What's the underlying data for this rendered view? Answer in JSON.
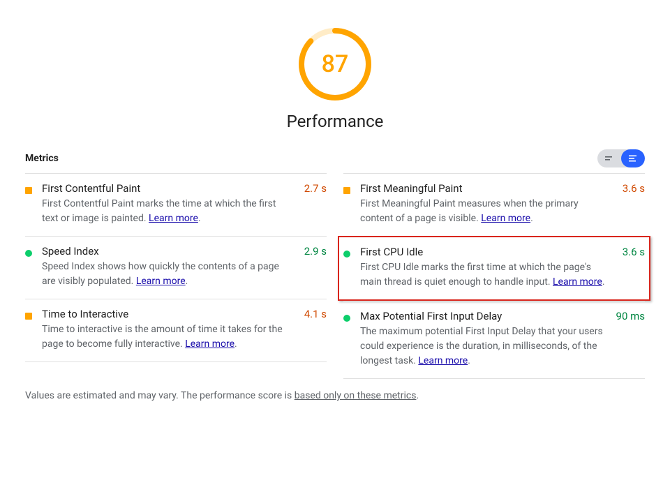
{
  "gauge": {
    "score": "87",
    "title": "Performance",
    "percent": 87,
    "color": "#FFA400",
    "bg": "#FFECC7"
  },
  "metrics_header": "Metrics",
  "learn_more_label": "Learn more",
  "left": [
    {
      "title": "First Contentful Paint",
      "value": "2.7 s",
      "status": "average",
      "shape": "square",
      "color": "#FFA400",
      "desc_pre": "First Contentful Paint marks the time at which the first text or image is painted. ",
      "desc_post": "."
    },
    {
      "title": "Speed Index",
      "value": "2.9 s",
      "status": "pass",
      "shape": "circle",
      "color": "#0CCE6B",
      "desc_pre": "Speed Index shows how quickly the contents of a page are visibly populated. ",
      "desc_post": "."
    },
    {
      "title": "Time to Interactive",
      "value": "4.1 s",
      "status": "average",
      "shape": "square",
      "color": "#FFA400",
      "desc_pre": "Time to interactive is the amount of time it takes for the page to become fully interactive. ",
      "desc_post": "."
    }
  ],
  "right": [
    {
      "title": "First Meaningful Paint",
      "value": "3.6 s",
      "status": "average",
      "shape": "square",
      "color": "#FFA400",
      "desc_pre": "First Meaningful Paint measures when the primary content of a page is visible. ",
      "desc_post": "."
    },
    {
      "title": "First CPU Idle",
      "value": "3.6 s",
      "status": "pass",
      "shape": "circle",
      "color": "#0CCE6B",
      "highlight": true,
      "desc_pre": "First CPU Idle marks the first time at which the page's main thread is quiet enough to handle input. ",
      "desc_post": "."
    },
    {
      "title": "Max Potential First Input Delay",
      "value": "90 ms",
      "status": "pass",
      "shape": "circle",
      "color": "#0CCE6B",
      "desc_pre": "The maximum potential First Input Delay that your users could experience is the duration, in milliseconds, of the longest task. ",
      "desc_post": "."
    }
  ],
  "footnote": {
    "pre": "Values are estimated and may vary. The performance score is ",
    "link": "based only on these metrics",
    "post": "."
  }
}
